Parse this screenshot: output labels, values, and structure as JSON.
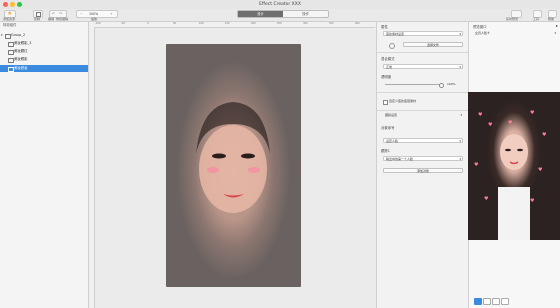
{
  "window": {
    "title": "Effect Creator XXX"
  },
  "toolbar": {
    "btn1_label": "添加资源",
    "btn2_label": "复制",
    "btn3_label": "撤销",
    "btn4_label": "恢复撤销",
    "zoom_value": "100%",
    "zoom_label": "缩放",
    "seg_design": "设计",
    "seg_operate": "操作",
    "right_label1": "实时预览",
    "right_label2": "工具",
    "right_label3": "帮助"
  },
  "left_panel": {
    "header": "特效组件",
    "items": [
      {
        "label": "Group_2"
      },
      {
        "label": "美妆眼影_3"
      },
      {
        "label": "美妆腮红"
      },
      {
        "label": "美妆眼影"
      },
      {
        "label": "美妆底妆"
      }
    ]
  },
  "ruler": {
    "ticks": [
      "-100",
      "-50",
      "0",
      "50",
      "100",
      "150",
      "200",
      "250",
      "300",
      "350",
      "400"
    ]
  },
  "properties": {
    "section_title": "属性",
    "face_makeup_label": "底妆素材设置",
    "select_file_btn": "选择文件",
    "blend_mode_label": "混合模式",
    "blend_mode_value": "正常",
    "opacity_label": "透明度",
    "opacity_value": "100%",
    "custom_checkbox_label": "自定义底妆底层素材",
    "tracking_label": "跟踪设置",
    "tracking_target_label": "对象序号",
    "tracking_target_value": "设定人脸",
    "follow_label": "跟踪1",
    "follow_value": "输出中的第一个人脸",
    "add_button": "添加对象"
  },
  "preview": {
    "header": "预览窗口",
    "dropdown_value": "全员人脸⑤"
  },
  "colors": {
    "selection": "#3a8be0",
    "heart": "#ff7a9c",
    "close": "#fe5f57",
    "minimize": "#febc2e",
    "maximize": "#28c840"
  }
}
